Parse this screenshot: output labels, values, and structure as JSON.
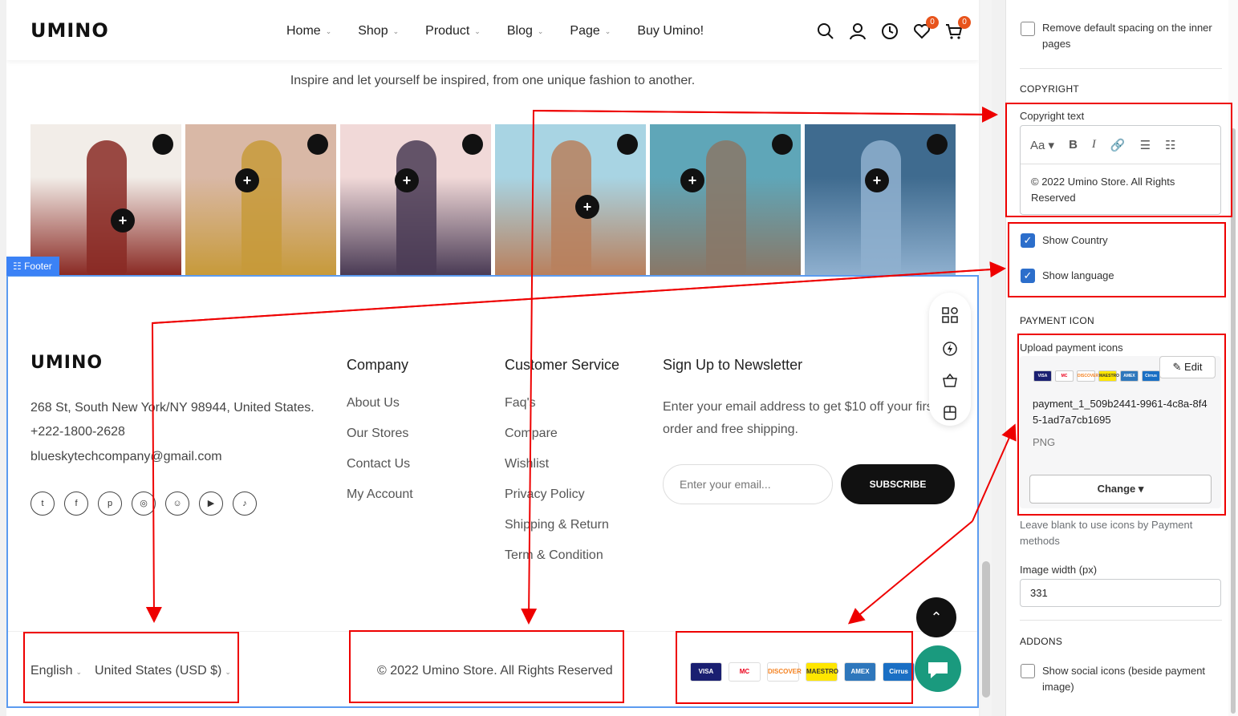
{
  "header": {
    "logo": "UMINO",
    "nav": [
      {
        "label": "Home",
        "chevron": true
      },
      {
        "label": "Shop",
        "chevron": true
      },
      {
        "label": "Product",
        "chevron": true
      },
      {
        "label": "Blog",
        "chevron": true
      },
      {
        "label": "Page",
        "chevron": true
      },
      {
        "label": "Buy Umino!",
        "chevron": false
      }
    ],
    "wishlist_count": "0",
    "cart_count": "0"
  },
  "gallery": {
    "tagline": "Inspire and let yourself be inspired, from one unique fashion to another.",
    "images": [
      {
        "colors": [
          "#f2ede8",
          "#8a2a24"
        ]
      },
      {
        "colors": [
          "#d9b8a6",
          "#c79a3a"
        ]
      },
      {
        "colors": [
          "#f1d9d8",
          "#4a3b55"
        ]
      },
      {
        "colors": [
          "#a8d4e3",
          "#b9805d"
        ]
      },
      {
        "colors": [
          "#5fa6b8",
          "#8a7766"
        ]
      },
      {
        "colors": [
          "#3f6b8f",
          "#8fb0cf"
        ]
      }
    ]
  },
  "footer": {
    "tag": "Footer",
    "logo": "UMINO",
    "address": "268 St, South New York/NY 98944, United States.",
    "phone": "+222-1800-2628",
    "email": "blueskytechcompany@gmail.com",
    "socials": [
      "twitter-icon",
      "facebook-icon",
      "pinterest-icon",
      "instagram-icon",
      "snapchat-icon",
      "youtube-icon",
      "tiktok-icon"
    ],
    "company": {
      "title": "Company",
      "links": [
        "About Us",
        "Our Stores",
        "Contact Us",
        "My Account"
      ]
    },
    "service": {
      "title": "Customer Service",
      "links": [
        "Faq's",
        "Compare",
        "Wishlist",
        "Privacy Policy",
        "Shipping & Return",
        "Term & Condition"
      ]
    },
    "newsletter": {
      "title": "Sign Up to Newsletter",
      "text_line1": "Enter your email address to get $10 off your first",
      "text_line2": "order and free shipping.",
      "placeholder": "Enter your email...",
      "button": "SUBSCRIBE"
    },
    "language": "English",
    "country": "United States (USD $)",
    "copyright": "© 2022 Umino Store. All Rights Reserved",
    "payments": [
      {
        "label": "VISA",
        "bg": "#1a1f71",
        "fg": "#ffffff"
      },
      {
        "label": "MC",
        "bg": "#ffffff",
        "fg": "#eb001b"
      },
      {
        "label": "DISCOVER",
        "bg": "#ffffff",
        "fg": "#f58220"
      },
      {
        "label": "MAESTRO",
        "bg": "#ffe600",
        "fg": "#333333"
      },
      {
        "label": "AMEX",
        "bg": "#2e77bc",
        "fg": "#ffffff"
      },
      {
        "label": "Cirrus",
        "bg": "#1a6fc4",
        "fg": "#ffffff"
      }
    ]
  },
  "panel": {
    "remove_spacing_label": "Remove default spacing on the inner pages",
    "copyright_section": "COPYRIGHT",
    "copyright_field_label": "Copyright text",
    "rte_font_label": "Aa",
    "copyright_text": "© 2022 Umino Store. All Rights Reserved",
    "show_country_label": "Show Country",
    "show_language_label": "Show language",
    "payment_section": "PAYMENT ICON",
    "upload_label": "Upload payment icons",
    "edit_label": "Edit",
    "file_name": "payment_1_509b2441-9961-4c8a-8f45-1ad7a7cb1695",
    "file_type": "PNG",
    "change_label": "Change",
    "help_text": "Leave blank to use icons by Payment methods",
    "width_label": "Image width (px)",
    "width_value": "331",
    "addons_section": "ADDONS",
    "show_social_label": "Show social icons (beside payment image)"
  },
  "accent_colors": {
    "annotation": "#e00000",
    "selection": "#5b9bf0",
    "checkbox": "#2c6ecb",
    "chat": "#1a9a7e"
  }
}
